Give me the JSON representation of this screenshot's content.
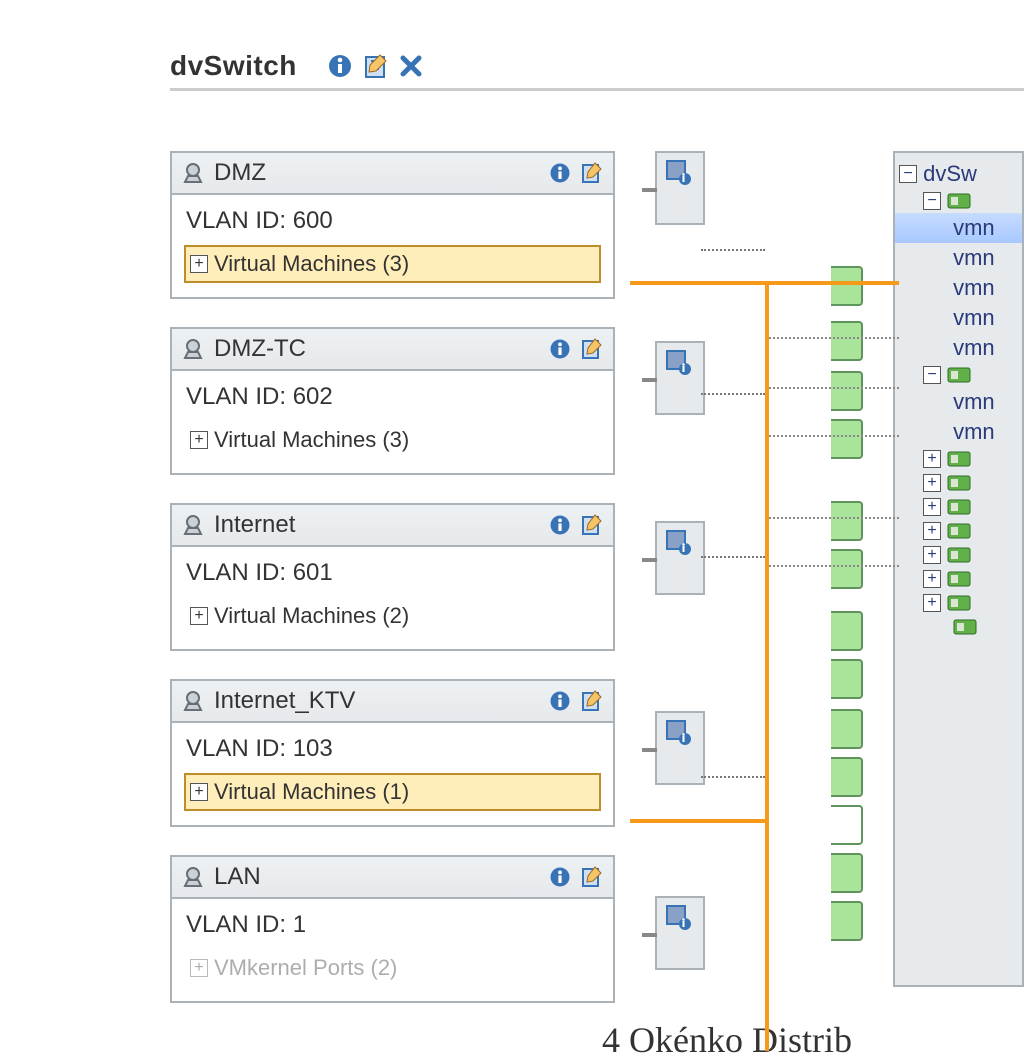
{
  "title": "dvSwitch",
  "portgroups": [
    {
      "name": "DMZ",
      "vlan": "VLAN ID: 600",
      "vm": "Virtual Machines (3)",
      "sel": true
    },
    {
      "name": "DMZ-TC",
      "vlan": "VLAN ID: 602",
      "vm": "Virtual Machines (3)",
      "sel": false
    },
    {
      "name": "Internet",
      "vlan": "VLAN ID: 601",
      "vm": "Virtual Machines (2)",
      "sel": false
    },
    {
      "name": "Internet_KTV",
      "vlan": "VLAN ID: 103",
      "vm": "Virtual Machines (1)",
      "sel": true
    },
    {
      "name": "LAN",
      "vlan": "VLAN ID: 1",
      "vm": "VMkernel Ports (2)",
      "sel": false
    }
  ],
  "tree": {
    "root": "dvSw",
    "vmn": "vmn"
  },
  "caption": "4  Okénko Distrib"
}
